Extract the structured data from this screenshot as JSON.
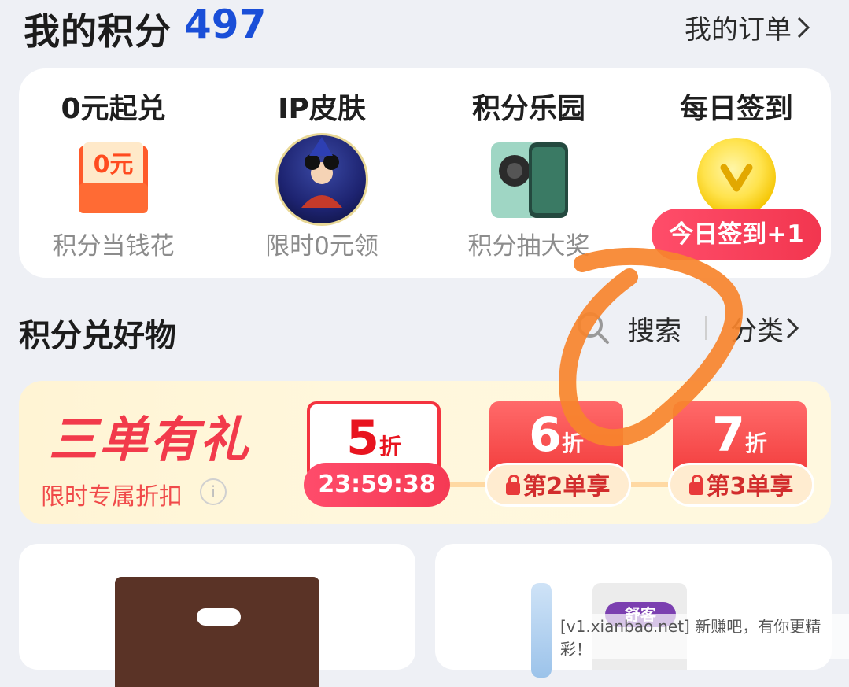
{
  "header": {
    "points_label": "我的积分",
    "points_value": "497",
    "orders_label": "我的订单"
  },
  "features": [
    {
      "title": "0元起兑",
      "subtitle": "积分当钱花",
      "icon": "coupon-icon",
      "icon_text": "0元"
    },
    {
      "title": "IP皮肤",
      "subtitle": "限时0元领",
      "icon": "character-avatar"
    },
    {
      "title": "积分乐园",
      "subtitle": "积分抽大奖",
      "icon": "phone-prize-image"
    },
    {
      "title": "每日签到",
      "subtitle": "",
      "icon": "coin-icon",
      "badge": "今日签到+1"
    }
  ],
  "section": {
    "title": "积分兑好物",
    "search_label": "搜索",
    "category_label": "分类"
  },
  "promo": {
    "title": "三单有礼",
    "subtitle": "限时专属折扣",
    "tiers": [
      {
        "discount": "5",
        "unit": "折",
        "pill": "23:59:38"
      },
      {
        "discount": "6",
        "unit": "折",
        "pill": "第2单享"
      },
      {
        "discount": "7",
        "unit": "折",
        "pill": "第3单享"
      }
    ]
  },
  "products": [
    {
      "image": "brown-bag-image"
    },
    {
      "image": "toothbrush-toothpaste-image",
      "brand_badge": "舒客"
    }
  ],
  "watermark": "[v1.xianbao.net] 新赚吧，有你更精彩！",
  "colors": {
    "accent_blue": "#1a4fd8",
    "accent_red": "#f23a4b",
    "annotation_orange": "#f7842c"
  }
}
